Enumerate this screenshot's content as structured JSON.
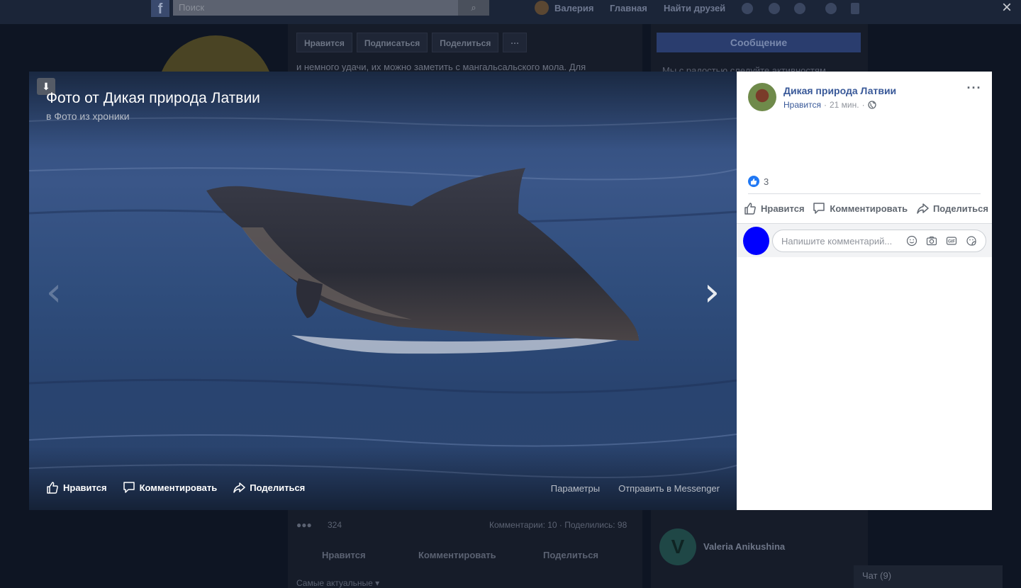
{
  "background_page": {
    "search_placeholder": "Поиск",
    "user_name": "Валерия",
    "nav_home": "Главная",
    "nav_find_friends": "Найти друзей",
    "action_like": "Нравится",
    "action_follow": "Подписаться",
    "action_share": "Поделиться",
    "action_more": "···",
    "message_button": "Сообщение",
    "post_text_snippet": "и немного удачи, их можно заметить с мангальсальского мола. Для",
    "right_text_snippet": "Мы с радостью следуйте активностям",
    "reactions_count": "324",
    "comments_shares": "Комментарии: 10 · Поделились: 98",
    "post_like": "Нравится",
    "post_comment": "Комментировать",
    "post_share": "Поделиться",
    "sort_label": "Самые актуальные ▾",
    "friend_initial": "V",
    "friend_name": "Valeria Anikushina",
    "chat_label": "Чат (9)"
  },
  "viewer": {
    "close_icon": "×",
    "title": "Фото от Дикая природа Латвии",
    "album": "в Фото из хроники",
    "like_label": "Нравится",
    "comment_label": "Комментировать",
    "share_label": "Поделиться",
    "options_label": "Параметры",
    "messenger_label": "Отправить в Messenger",
    "prev_arrow": "‹",
    "next_arrow": "›"
  },
  "panel": {
    "page_name": "Дикая природа Латвии",
    "page_like": "Нравится",
    "time": "21 мин.",
    "more": "···",
    "reaction_count": "3",
    "like_label": "Нравится",
    "comment_label": "Комментировать",
    "share_label": "Поделиться",
    "comment_placeholder": "Напишите комментарий..."
  },
  "colors": {
    "link_blue": "#385898",
    "like_blue": "#2078f4",
    "avatar_blue": "#0000ff"
  }
}
